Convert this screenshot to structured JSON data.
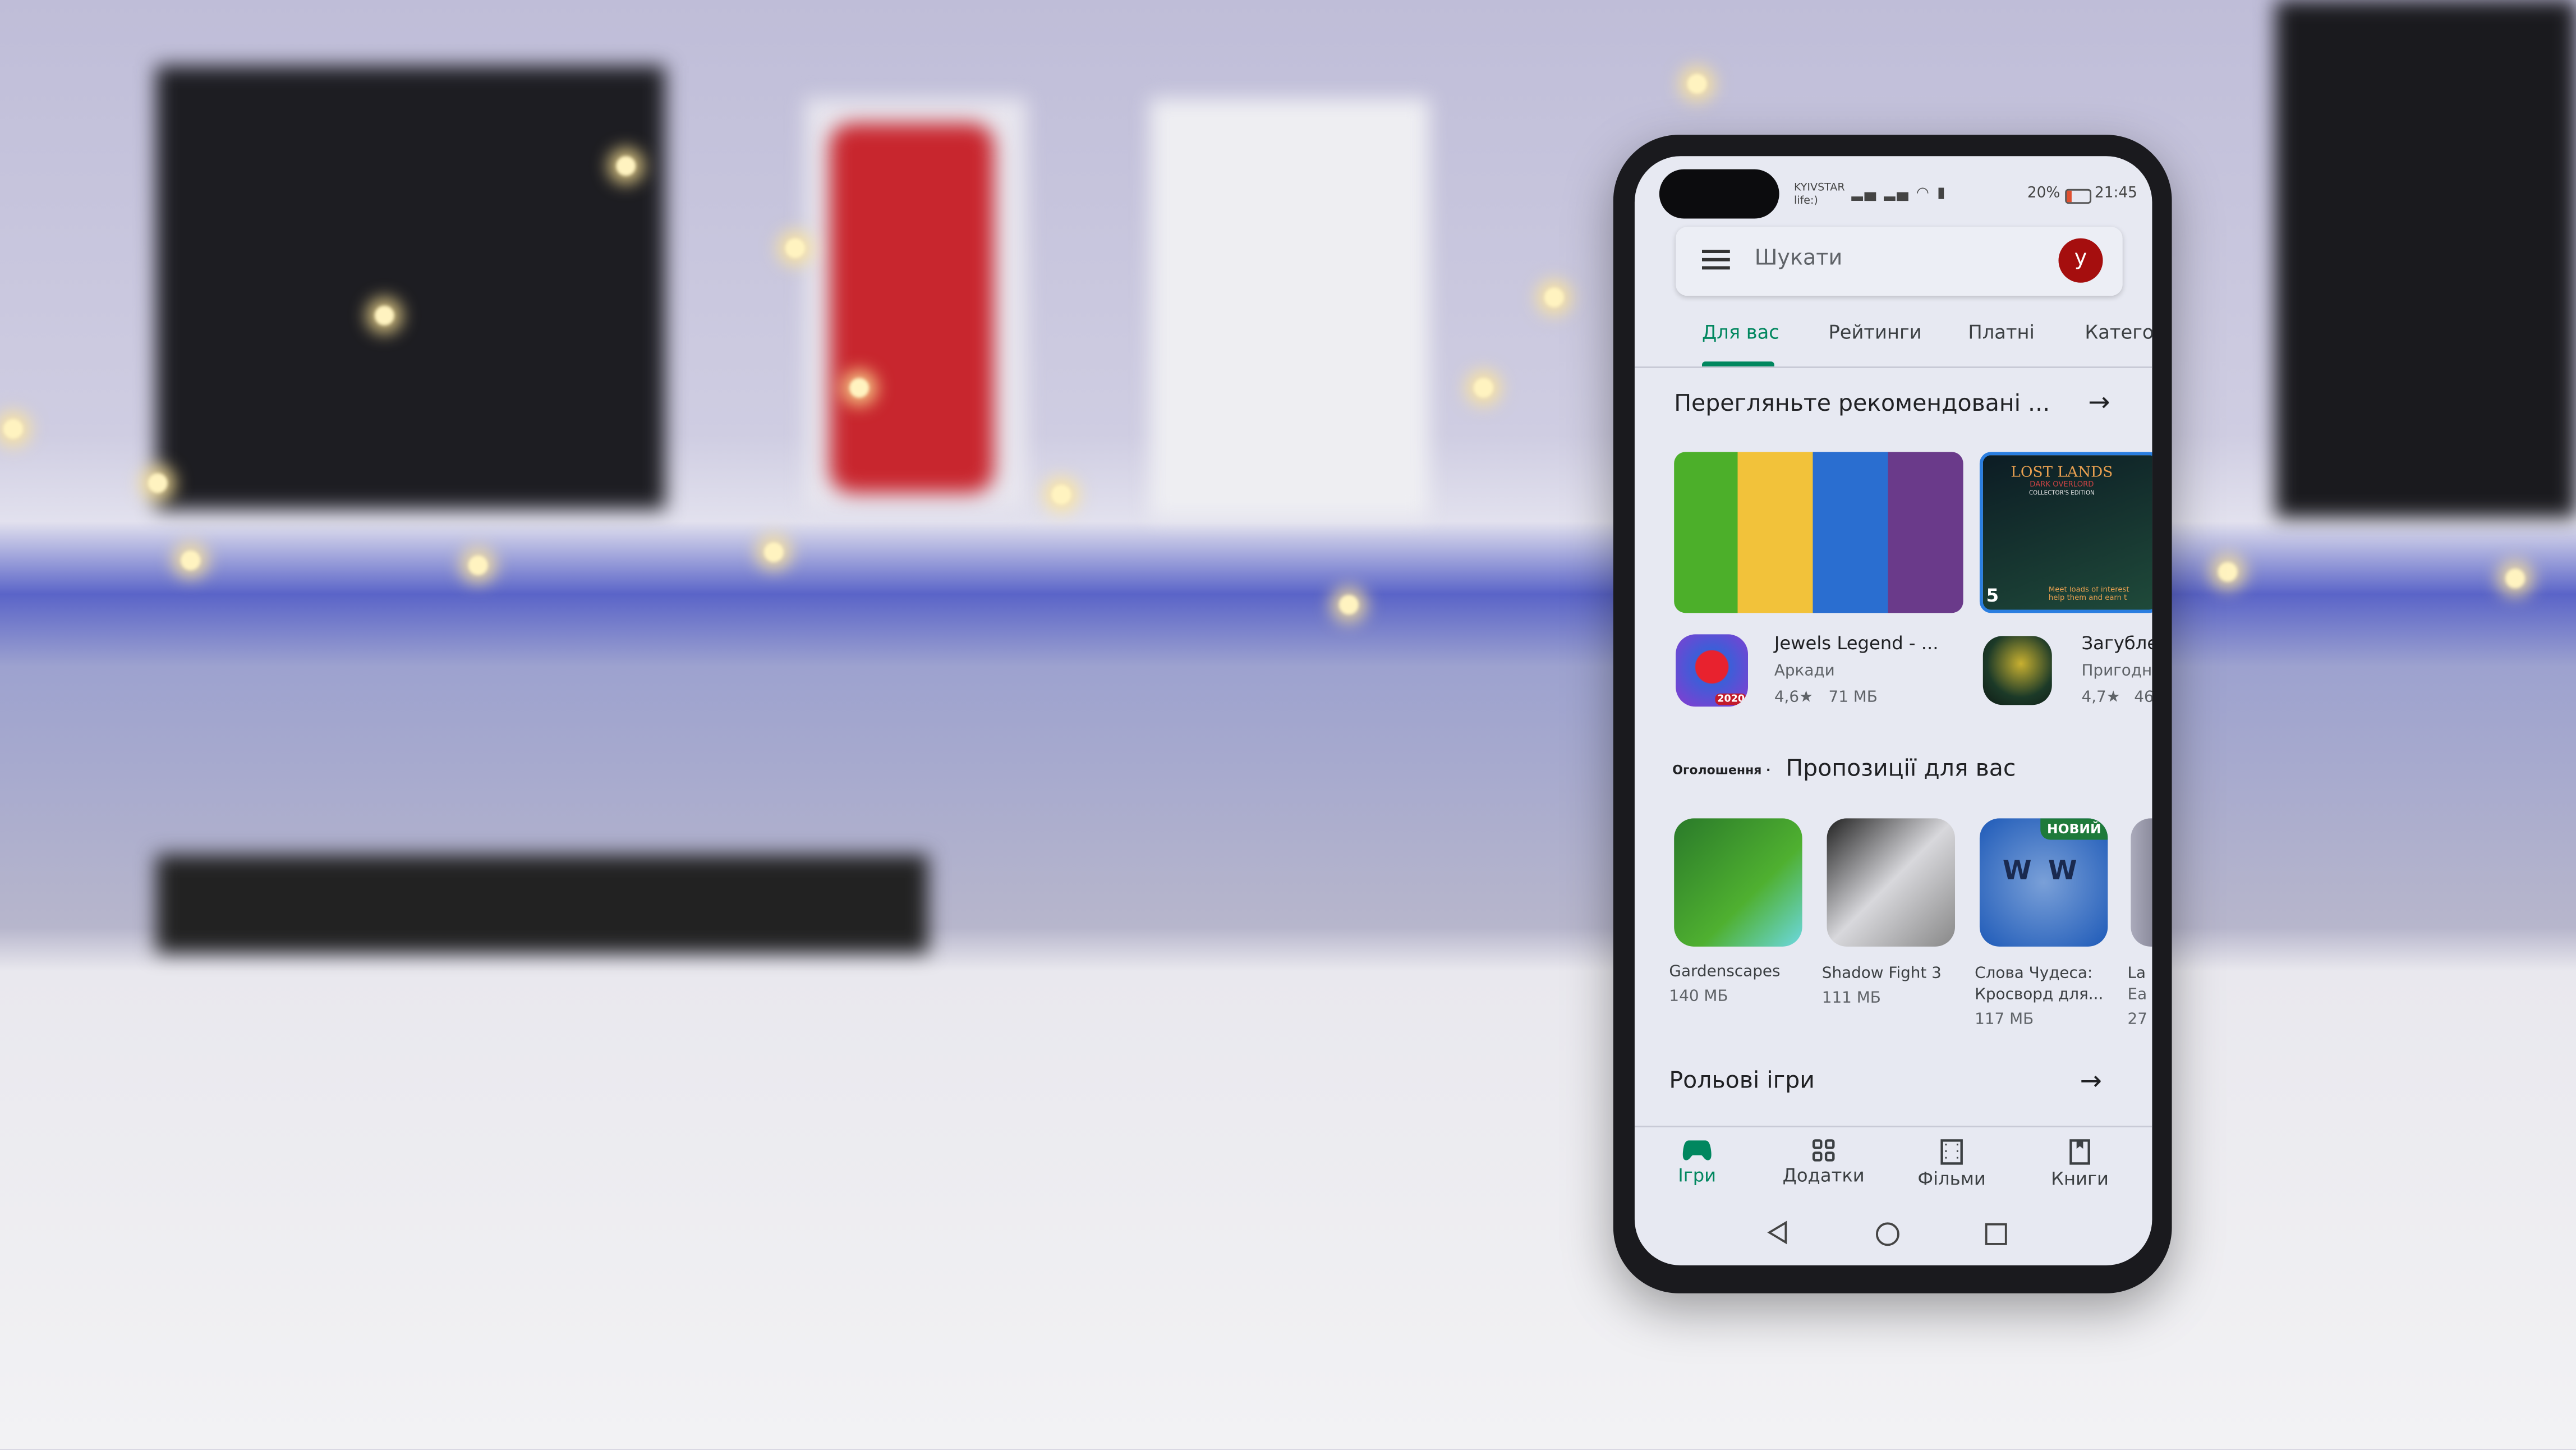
{
  "status_bar": {
    "carrier": "KYIVSTAR",
    "carrier2": "life:)",
    "battery": "20%",
    "time": "21:45"
  },
  "search": {
    "placeholder": "Шукати",
    "avatar_letter": "y"
  },
  "tabs": [
    {
      "label": "Для вас",
      "active": true
    },
    {
      "label": "Рейтинги"
    },
    {
      "label": "Платні"
    },
    {
      "label": "Катего"
    }
  ],
  "recommended": {
    "title": "Перегляньте рекомендовані ...",
    "banner2": {
      "title": "LOST LANDS",
      "subtitle": "DARK OVERLORD",
      "edition": "COLLECTOR'S EDITION",
      "badge": "5",
      "caption": "Meet loads of interest help them and earn t"
    },
    "apps": [
      {
        "name": "Jewels Legend - ...",
        "category": "Аркади",
        "rating": "4,6★",
        "size": "71 МБ",
        "badge": "2020"
      },
      {
        "name": "Загубле",
        "category": "Пригодн",
        "rating": "4,7★",
        "size": "46"
      }
    ]
  },
  "ads": {
    "label": "Оголошення ·",
    "title": "Пропозиції для вас",
    "apps": [
      {
        "name": "Gardenscapes",
        "size": "140 МБ"
      },
      {
        "name": "Shadow Fight 3",
        "size": "111 МБ"
      },
      {
        "name": "Слова Чудеса:",
        "name2": "Кросворд для...",
        "size": "117 МБ",
        "badge": "НОВИЙ"
      },
      {
        "name": "La",
        "name2": "Ea",
        "size": "27"
      }
    ]
  },
  "rpg": {
    "title": "Рольові ігри"
  },
  "bottom_nav": [
    {
      "label": "Ігри",
      "icon": "gamepad-icon",
      "active": true
    },
    {
      "label": "Додатки",
      "icon": "apps-grid-icon"
    },
    {
      "label": "Фільми",
      "icon": "film-icon"
    },
    {
      "label": "Книги",
      "icon": "book-icon"
    }
  ],
  "colors": {
    "accent": "#01875f",
    "avatar": "#a50e0e"
  }
}
